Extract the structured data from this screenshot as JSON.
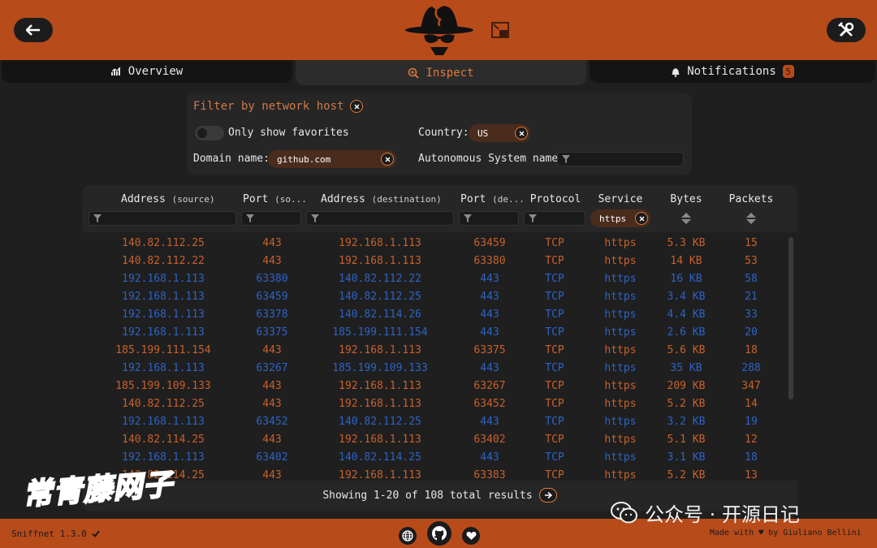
{
  "colors": {
    "accent": "#b84b1a",
    "outgoing": "#c8612c",
    "incoming": "#2d63c6",
    "background": "#1f1f1f"
  },
  "header": {
    "back_icon": "arrow-left-icon",
    "logo": "spy-hat-logo",
    "minimize_icon": "thumbnail-mode-icon",
    "settings_icon": "wrench-screwdriver-icon"
  },
  "tabs": [
    {
      "label": "Overview",
      "icon": "chart-icon"
    },
    {
      "label": "Inspect",
      "icon": "magnifier-icon",
      "active": true
    },
    {
      "label": "Notifications",
      "icon": "bell-icon",
      "badge": "5"
    }
  ],
  "filters": {
    "title": "Filter by network host",
    "favorites_label": "Only show favorites",
    "country_label": "Country:",
    "country_value": "US",
    "domain_label": "Domain name:",
    "domain_value": "github.com",
    "asn_label": "Autonomous System name:"
  },
  "table": {
    "headers": [
      {
        "main": "Address",
        "sub": "(source)"
      },
      {
        "main": "Port",
        "sub": "(so..."
      },
      {
        "main": "Address",
        "sub": "(destination)"
      },
      {
        "main": "Port",
        "sub": "(de..."
      },
      {
        "main": "Protocol",
        "sub": ""
      },
      {
        "main": "Service",
        "sub": ""
      },
      {
        "main": "Bytes",
        "sub": ""
      },
      {
        "main": "Packets",
        "sub": ""
      }
    ],
    "service_filter": "https",
    "rows": [
      {
        "dir": "out",
        "cells": [
          "140.82.112.25",
          "443",
          "192.168.1.113",
          "63459",
          "TCP",
          "https",
          "5.3 KB",
          "15"
        ]
      },
      {
        "dir": "out",
        "cells": [
          "140.82.112.22",
          "443",
          "192.168.1.113",
          "63380",
          "TCP",
          "https",
          "14 KB",
          "53"
        ]
      },
      {
        "dir": "in",
        "cells": [
          "192.168.1.113",
          "63380",
          "140.82.112.22",
          "443",
          "TCP",
          "https",
          "16 KB",
          "58"
        ]
      },
      {
        "dir": "in",
        "cells": [
          "192.168.1.113",
          "63459",
          "140.82.112.25",
          "443",
          "TCP",
          "https",
          "3.4 KB",
          "21"
        ]
      },
      {
        "dir": "in",
        "cells": [
          "192.168.1.113",
          "63378",
          "140.82.114.26",
          "443",
          "TCP",
          "https",
          "4.4 KB",
          "33"
        ]
      },
      {
        "dir": "in",
        "cells": [
          "192.168.1.113",
          "63375",
          "185.199.111.154",
          "443",
          "TCP",
          "https",
          "2.6 KB",
          "20"
        ]
      },
      {
        "dir": "out",
        "cells": [
          "185.199.111.154",
          "443",
          "192.168.1.113",
          "63375",
          "TCP",
          "https",
          "5.6 KB",
          "18"
        ]
      },
      {
        "dir": "in",
        "cells": [
          "192.168.1.113",
          "63267",
          "185.199.109.133",
          "443",
          "TCP",
          "https",
          "35 KB",
          "288"
        ]
      },
      {
        "dir": "out",
        "cells": [
          "185.199.109.133",
          "443",
          "192.168.1.113",
          "63267",
          "TCP",
          "https",
          "209 KB",
          "347"
        ]
      },
      {
        "dir": "out",
        "cells": [
          "140.82.112.25",
          "443",
          "192.168.1.113",
          "63452",
          "TCP",
          "https",
          "5.2 KB",
          "14"
        ]
      },
      {
        "dir": "in",
        "cells": [
          "192.168.1.113",
          "63452",
          "140.82.112.25",
          "443",
          "TCP",
          "https",
          "3.2 KB",
          "19"
        ]
      },
      {
        "dir": "out",
        "cells": [
          "140.82.114.25",
          "443",
          "192.168.1.113",
          "63402",
          "TCP",
          "https",
          "5.1 KB",
          "12"
        ]
      },
      {
        "dir": "in",
        "cells": [
          "192.168.1.113",
          "63402",
          "140.82.114.25",
          "443",
          "TCP",
          "https",
          "3.1 KB",
          "18"
        ]
      },
      {
        "dir": "out",
        "cells": [
          "140.82.114.25",
          "443",
          "192.168.1.113",
          "63383",
          "TCP",
          "https",
          "5.2 KB",
          "13"
        ]
      }
    ],
    "pager": "Showing 1-20 of 108 total results"
  },
  "footer": {
    "version": "Sniffnet 1.3.0",
    "made_with": "Made with ♥ by Giuliano Bellini",
    "icons": [
      "globe-icon",
      "github-icon",
      "heart-icon"
    ]
  },
  "watermarks": {
    "left": "常青藤网子",
    "right": "公众号 · 开源日记"
  }
}
